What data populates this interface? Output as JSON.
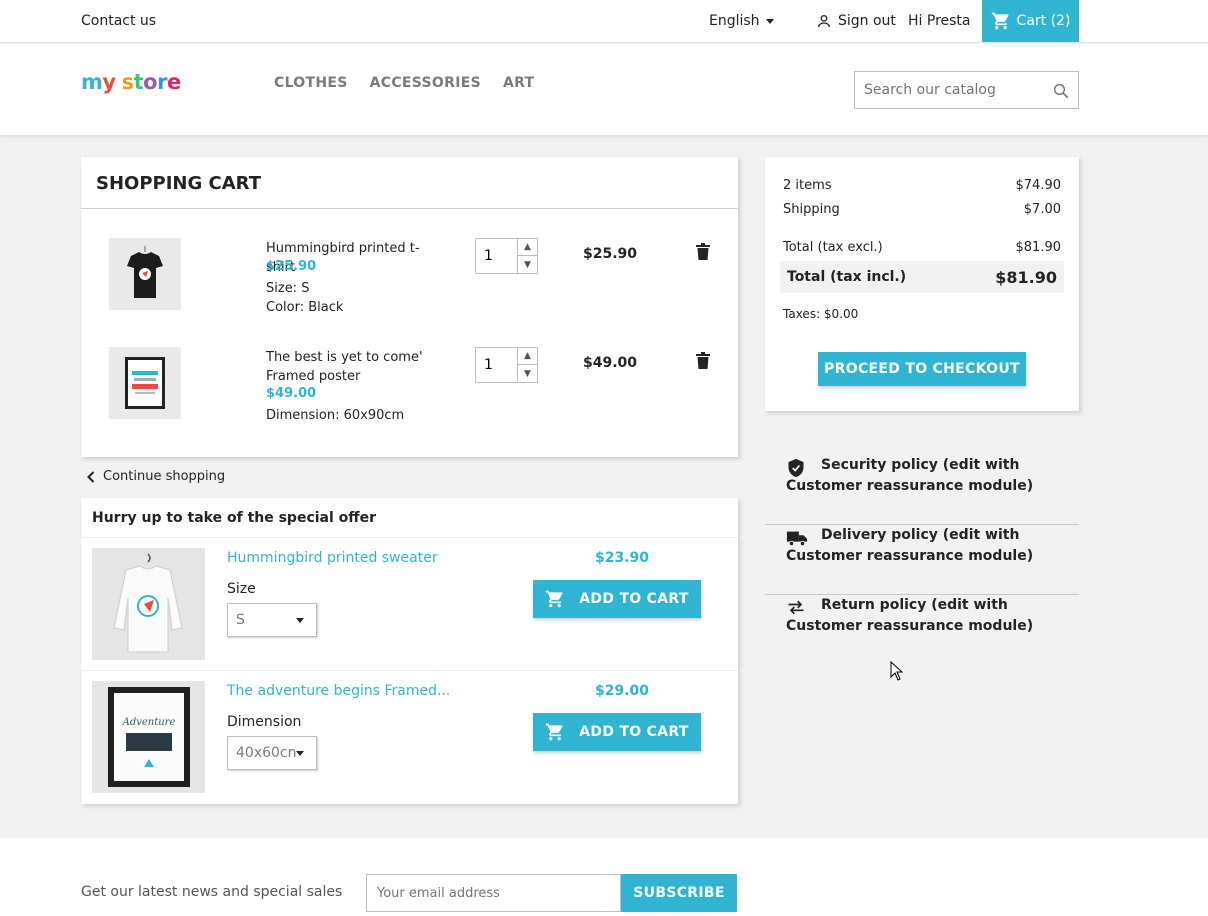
{
  "topbar": {
    "contact": "Contact us",
    "language": "English",
    "signout": "Sign out",
    "greeting": "Hi Presta",
    "cart": "Cart (2)"
  },
  "header": {
    "logo": "my store",
    "nav": [
      "CLOTHES",
      "ACCESSORIES",
      "ART"
    ],
    "search_placeholder": "Search our catalog"
  },
  "cart": {
    "title": "SHOPPING CART",
    "items": [
      {
        "name": "Hummingbird printed t-shirt",
        "unit_price": "$25.90",
        "attrs": [
          "Size: S",
          "Color: Black"
        ],
        "quantity": "1",
        "total": "$25.90"
      },
      {
        "name": "The best is yet to come' Framed poster",
        "unit_price": "$49.00",
        "attrs": [
          "Dimension: 60x90cm"
        ],
        "quantity": "1",
        "total": "$49.00"
      }
    ],
    "continue": "Continue shopping"
  },
  "offer": {
    "title": "Hurry up to take of the special offer",
    "products": [
      {
        "name": "Hummingbird printed sweater",
        "option_label": "Size",
        "option_value": "S",
        "price": "$23.90",
        "button": "ADD TO CART"
      },
      {
        "name": "The adventure begins Framed...",
        "option_label": "Dimension",
        "option_value": "40x60cn",
        "price": "$29.00",
        "button": "ADD TO CART"
      }
    ]
  },
  "summary": {
    "items_label": "2 items",
    "items_value": "$74.90",
    "shipping_label": "Shipping",
    "shipping_value": "$7.00",
    "excl_label": "Total (tax excl.)",
    "excl_value": "$81.90",
    "incl_label": "Total (tax incl.)",
    "incl_value": "$81.90",
    "taxes": "Taxes: $0.00",
    "checkout": "PROCEED TO CHECKOUT"
  },
  "reassurance": [
    {
      "icon": "shield-icon",
      "text": "Security policy (edit with Customer reassurance module)"
    },
    {
      "icon": "truck-icon",
      "text": "Delivery policy (edit with Customer reassurance module)"
    },
    {
      "icon": "swap-arrows-icon",
      "text": "Return policy (edit with Customer reassurance module)"
    }
  ],
  "footer": {
    "newsletter_text": "Get our latest news and special sales",
    "email_placeholder": "Your email address",
    "subscribe": "SUBSCRIBE"
  },
  "colors": {
    "accent": "#2fb5d2",
    "background": "#f1f1f1",
    "text": "#232323"
  }
}
